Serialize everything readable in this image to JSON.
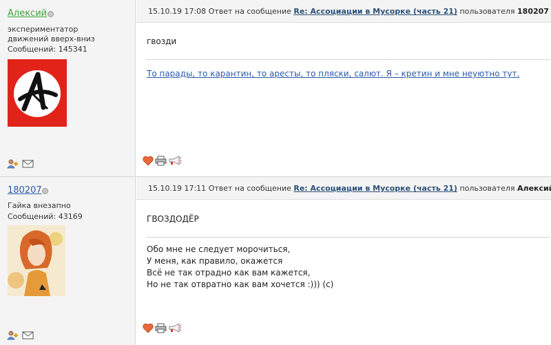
{
  "posts": [
    {
      "user": {
        "name": "Алексий",
        "name_color": "#3aa63a",
        "status": "экспериментатор движений вверх-вниз",
        "messages": "Сообщений: 145341",
        "avatar": "red-anarchy-symbol-avatar"
      },
      "header": {
        "datetime": "15.10.19 17:08",
        "reply_prefix": "Ответ на сообщение",
        "thread": "Re: Ассоциации в Мусорке (часть 21)",
        "user_prefix": "пользователя",
        "reply_to": "180207"
      },
      "body": "гвозди",
      "signature": "То парады, то карантин, то аресты, то пляски, салют. Я – кретин и мне неуютно тут.",
      "actions": [
        "heart-icon",
        "print-icon",
        "megaphone-icon"
      ],
      "user_actions": [
        "add-user-icon",
        "mail-icon"
      ]
    },
    {
      "user": {
        "name": "180207",
        "name_color": "#2a5aa8",
        "status": "Гайка внезапно",
        "messages": "Сообщений: 43169",
        "avatar": "girl-illustration-avatar"
      },
      "header": {
        "datetime": "15.10.19 17:11",
        "reply_prefix": "Ответ на сообщение",
        "thread": "Re: Ассоциации в Мусорке (часть 21)",
        "user_prefix": "пользователя",
        "reply_to": "Алексий"
      },
      "body": "ГВОЗДОДЁР",
      "signature_lines": [
        "Обо мне не следует морочиться,",
        "У меня, как правило, окажется",
        "Всё не так отрадно как вам кажется,",
        "Но не так отвратно как вам хочется :))) (c)"
      ],
      "actions": [
        "heart-icon",
        "print-icon",
        "megaphone-icon"
      ],
      "user_actions": [
        "add-user-icon",
        "mail-icon"
      ]
    }
  ]
}
